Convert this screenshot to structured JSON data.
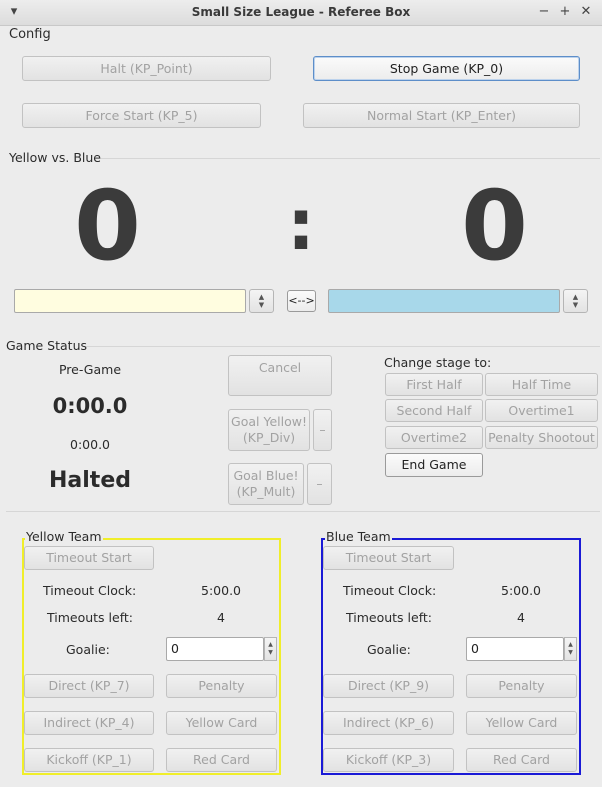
{
  "window": {
    "title": "Small Size League - Referee Box",
    "menu_glyph": "▾",
    "minimize": "−",
    "maximize": "+",
    "close": "✕"
  },
  "menu": {
    "config": "Config"
  },
  "top_buttons": {
    "halt": "Halt (KP_Point)",
    "stop": "Stop Game (KP_0)",
    "force_start": "Force Start (KP_5)",
    "normal_start": "Normal Start (KP_Enter)"
  },
  "score": {
    "group_title": "Yellow vs. Blue",
    "yellow": "0",
    "separator": ":",
    "blue": "0",
    "yellow_team_name": "",
    "blue_team_name": "",
    "swap_label": "<-->",
    "yellow_color": "#fffde0",
    "blue_color": "#a8d8ea"
  },
  "game_status": {
    "group_title": "Game Status",
    "stage": "Pre-Game",
    "time_main": "0:00.0",
    "time_secondary": "0:00.0",
    "state": "Halted",
    "cancel": "Cancel",
    "goal_yellow": "Goal Yellow!\n(KP_Div)",
    "goal_blue": "Goal Blue!\n(KP_Mult)",
    "minus": "–"
  },
  "change_stage": {
    "label": "Change stage to:",
    "first_half": "First Half",
    "half_time": "Half Time",
    "second_half": "Second Half",
    "overtime1": "Overtime1",
    "overtime2": "Overtime2",
    "penalty_shootout": "Penalty Shootout",
    "end_game": "End Game"
  },
  "yellow_team": {
    "title": "Yellow Team",
    "border_color": "#f0ee2a",
    "timeout_start": "Timeout Start",
    "timeout_clock_label": "Timeout Clock:",
    "timeout_clock": "5:00.0",
    "timeouts_left_label": "Timeouts left:",
    "timeouts_left": "4",
    "goalie_label": "Goalie:",
    "goalie_value": "0",
    "direct": "Direct (KP_7)",
    "penalty": "Penalty",
    "indirect": "Indirect (KP_4)",
    "yellow_card": "Yellow Card",
    "kickoff": "Kickoff (KP_1)",
    "red_card": "Red Card"
  },
  "blue_team": {
    "title": "Blue Team",
    "border_color": "#1a1ad6",
    "timeout_start": "Timeout Start",
    "timeout_clock_label": "Timeout Clock:",
    "timeout_clock": "5:00.0",
    "timeouts_left_label": "Timeouts left:",
    "timeouts_left": "4",
    "goalie_label": "Goalie:",
    "goalie_value": "0",
    "direct": "Direct (KP_9)",
    "penalty": "Penalty",
    "indirect": "Indirect (KP_6)",
    "yellow_card": "Yellow Card",
    "kickoff": "Kickoff (KP_3)",
    "red_card": "Red Card"
  }
}
